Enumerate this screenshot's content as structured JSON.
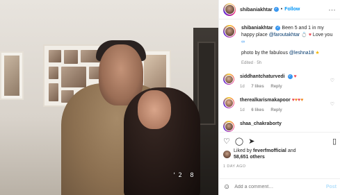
{
  "post": {
    "username": "shibaniakhtar",
    "follow_label": "Follow",
    "photo_tag": "'2 8"
  },
  "caption": {
    "username": "shibaniakhtar",
    "text_1": "Been 5 and 1 in my happy place",
    "mention": "@faroutakhtar",
    "text_2": "Love you",
    "credit_text": "photo by the fabulous",
    "credit_mention": "@leshna18",
    "edited": "Edited · 5h"
  },
  "comments": [
    {
      "username": "siddhantchaturvedi",
      "text": "",
      "age": "1d",
      "likes": "7 likes",
      "reply": "Reply"
    },
    {
      "username": "therealkarismakapoor",
      "text": "",
      "age": "1d",
      "likes": "6 likes",
      "reply": "Reply"
    },
    {
      "username": "shaa_chakraborty",
      "text": "",
      "age": "",
      "likes": "",
      "reply": ""
    }
  ],
  "engagement": {
    "liked_by_prefix": "Liked by",
    "liked_by_user": "feverfmofficial",
    "liked_by_and": "and",
    "likes_count": "58,651 others",
    "timestamp": "1 DAY AGO"
  },
  "comment_box": {
    "placeholder": "Add a comment…",
    "post_label": "Post"
  },
  "colors": {
    "follow": "#0095f6",
    "heart": "#ed4956"
  }
}
